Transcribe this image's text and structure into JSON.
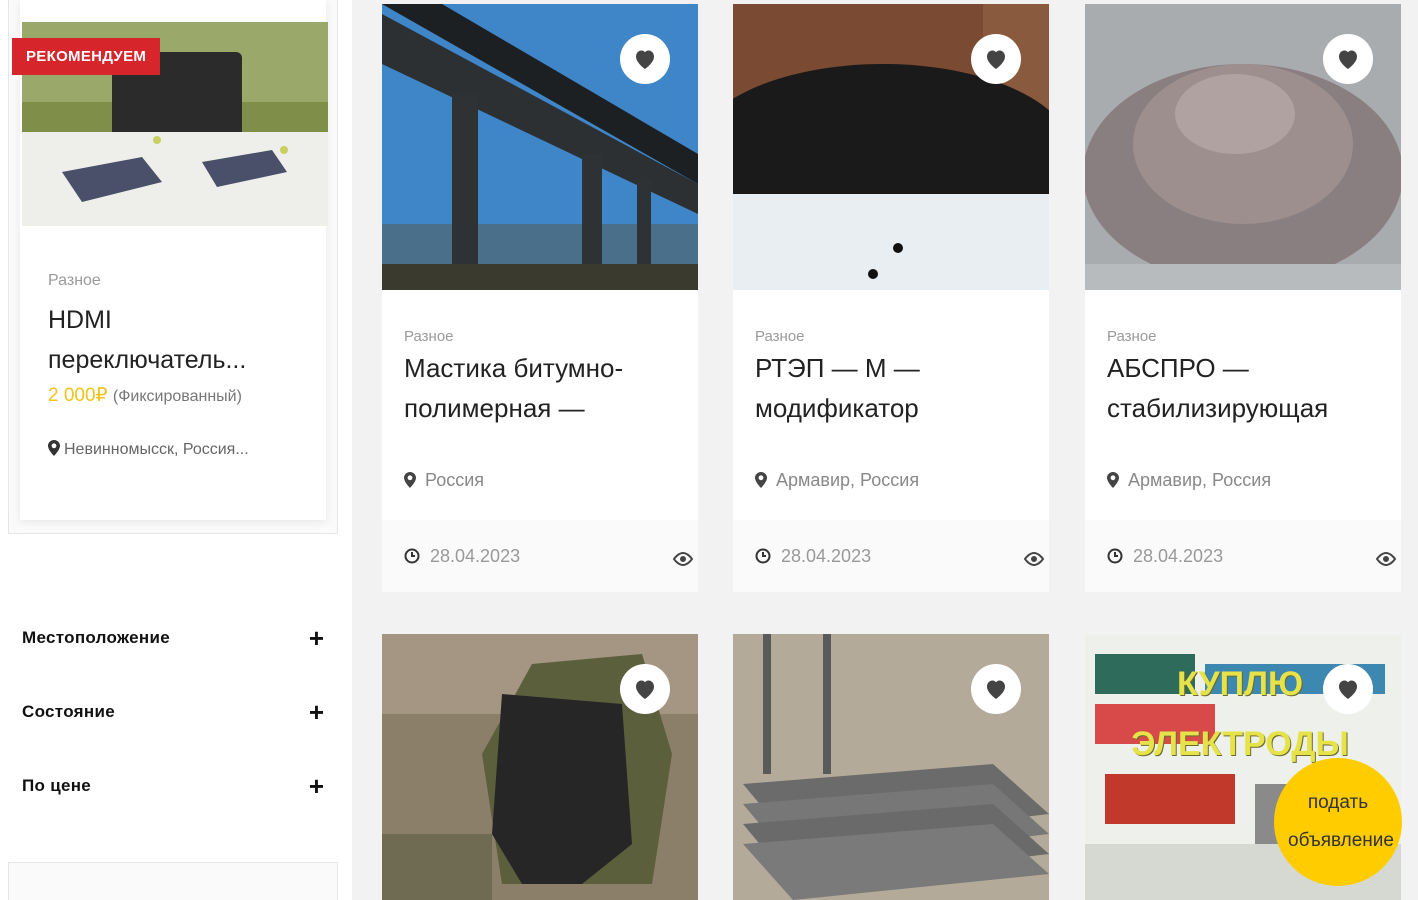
{
  "sidebar": {
    "featured": {
      "badge": "РЕКОМЕНДУЕМ",
      "category": "Разное",
      "title": "HDMI переключатель...",
      "price": "2 000₽",
      "price_type": "(Фиксированный)",
      "location": "Невинномысск, Россия..."
    },
    "filters": [
      {
        "label": "Местоположение"
      },
      {
        "label": "Состояние"
      },
      {
        "label": "По цене"
      }
    ]
  },
  "listings": [
    {
      "category": "Разное",
      "title": "Мастика битумно-полимерная —",
      "location": "Россия",
      "date": "28.04.2023"
    },
    {
      "category": "Разное",
      "title": "РТЭП — М — модификатор",
      "location": "Армавир, Россия",
      "date": "28.04.2023"
    },
    {
      "category": "Разное",
      "title": "АБСПРО — стабилизирующая",
      "location": "Армавир, Россия",
      "date": "28.04.2023"
    },
    {
      "category": "",
      "title": "",
      "location": "",
      "date": ""
    },
    {
      "category": "",
      "title": "",
      "location": "",
      "date": ""
    },
    {
      "category": "",
      "title": "",
      "location": "",
      "date": "",
      "image_text": "КУПЛЮ ЭЛЕКТРОДЫ"
    }
  ],
  "fab": {
    "label": "подать объявление"
  },
  "colors": {
    "accent_red": "#d6262c",
    "price_yellow": "#f0c419",
    "fab_yellow": "#ffcc00"
  }
}
